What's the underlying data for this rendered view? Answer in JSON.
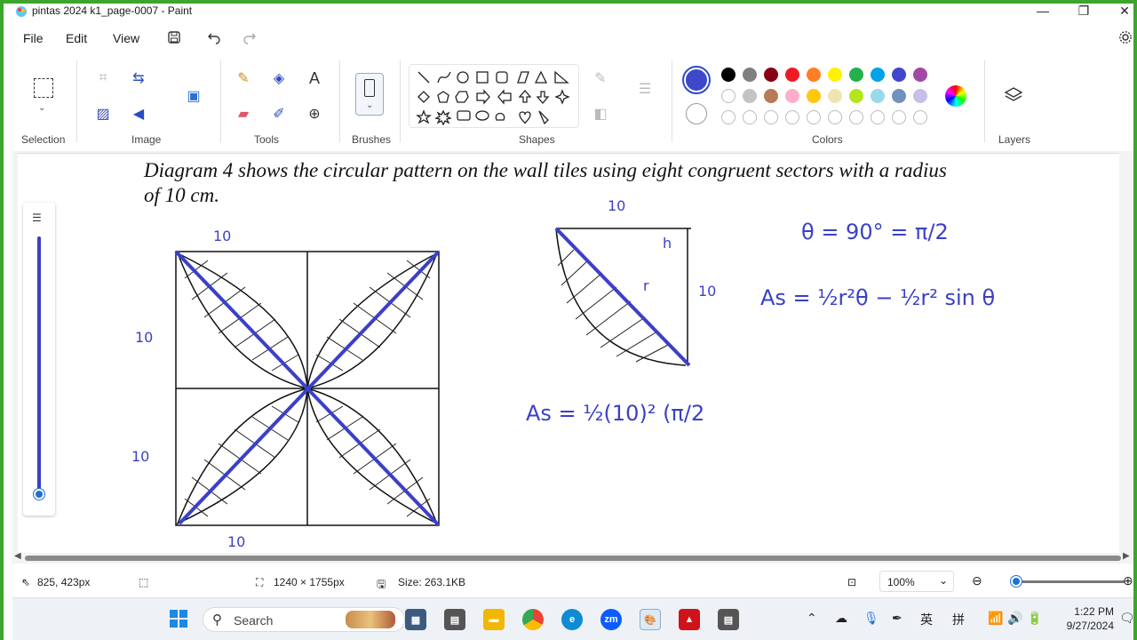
{
  "window": {
    "title": "pintas 2024 k1_page-0007 - Paint",
    "minimize_label": "—",
    "maximize_label": "❐",
    "close_label": "✕"
  },
  "menu": {
    "file": "File",
    "edit": "Edit",
    "view": "View"
  },
  "ribbon": {
    "groups": {
      "selection": "Selection",
      "image": "Image",
      "tools": "Tools",
      "brushes": "Brushes",
      "shapes": "Shapes",
      "colors": "Colors",
      "layers": "Layers"
    },
    "primary_color": "#3f48cc",
    "palette_row1": [
      "#000000",
      "#7f7f7f",
      "#880015",
      "#ed1c24",
      "#ff7f27",
      "#fff200",
      "#22b14c",
      "#00a2e8",
      "#3f48cc",
      "#a349a4"
    ],
    "palette_row2": [
      "#ffffff",
      "#c3c3c3",
      "#b97a57",
      "#ffaec9",
      "#ffc90e",
      "#efe4b0",
      "#b5e61d",
      "#99d9ea",
      "#7092be",
      "#c8bfe7"
    ]
  },
  "document": {
    "heading_line1": "Diagram 4 shows the circular pattern on the wall tiles using eight congruent sectors with a radius",
    "heading_line2": "of 10 cm.",
    "annotations": {
      "top_10": "10",
      "left_10": "10",
      "left_lower_10": "10",
      "bottom_10": "10",
      "sector_top_10": "10",
      "sector_right_10": "10",
      "sector_h": "h",
      "sector_r": "r",
      "theta": "θ = 90° = π/2",
      "area_formula": "As = ½r²θ − ½r² sin θ",
      "area_work": "As = ½(10)² (π/2"
    }
  },
  "status": {
    "cursor_pos": "825, 423px",
    "canvas_size": "1240 × 1755px",
    "file_size": "Size: 263.1KB",
    "zoom": "100%"
  },
  "taskbar": {
    "search_placeholder": "Search",
    "time": "1:22 PM",
    "date": "9/27/2024",
    "ime": "英",
    "ime2": "拼"
  }
}
